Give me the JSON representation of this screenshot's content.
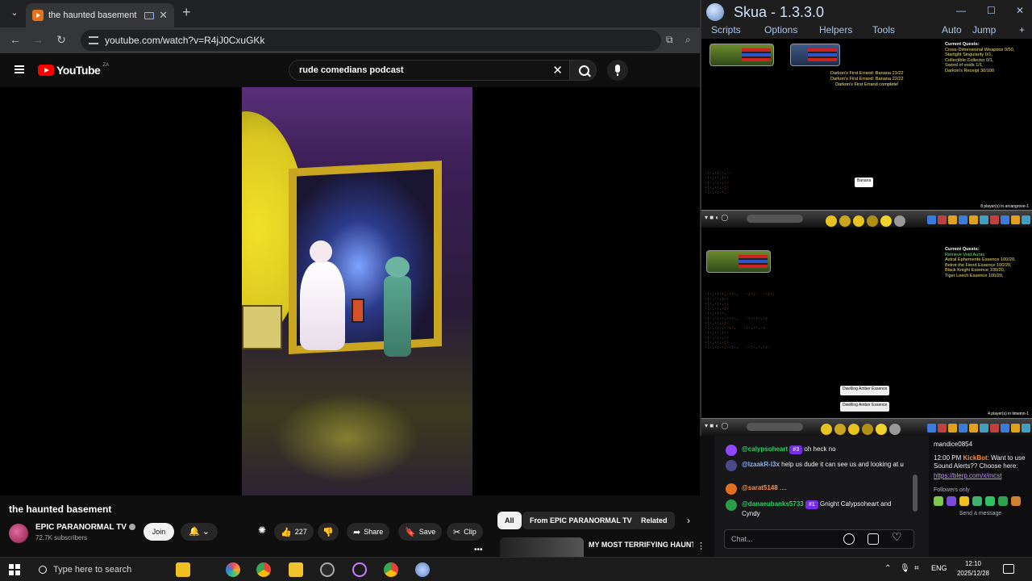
{
  "browser": {
    "tab_title": "the haunted basement - Yo",
    "url": "youtube.com/watch?v=R4jJ0CxuGKk"
  },
  "youtube": {
    "logo_text": "YouTube",
    "country_code": "ZA",
    "search_query": "rude comedians podcast",
    "video_title": "the haunted basement",
    "channel_name": "EPIC PARANORMAL TV",
    "subscribers": "72.7K subscribers",
    "join_label": "Join",
    "likes": "227",
    "share_label": "Share",
    "save_label": "Save",
    "clip_label": "Clip",
    "chips": [
      "All",
      "From EPIC PARANORMAL TV",
      "Related"
    ],
    "reco_title": "MY MOST TERRIFYING HAUNTING | Pocotown School"
  },
  "skua": {
    "title": "Skua - 1.3.3.0",
    "menu": [
      "Scripts",
      "Options",
      "Helpers",
      "Tools",
      "Auto",
      "Jump"
    ],
    "top": {
      "quest_header": "Current Quests:",
      "quests": [
        "Cross-Dimensional Weapons 0/50,",
        "Starlight Singularity 0/1,",
        "Collectible Collector 0/1,",
        "Sword of voids 1/1,",
        "Darkon's Receipt 30/100"
      ],
      "errand_lines": [
        "Darkon's First Errand: Banana 21/22",
        "Darkon's First Errand: Banana 22/22",
        "Darkon's First Errand complete!"
      ],
      "npc": "Banana",
      "players": "8 player(s) in arcangrove-1"
    },
    "bottom": {
      "quest_header": "Current Quests:",
      "quest_sub": "Retrieve Void Auras",
      "quests": [
        "Astral Ephemerite Essence 100/20,",
        "Belrot the Fiend Essence 100/20,",
        "Black Knight Essence 100/20,",
        "Tiger Leech Essence 100/20,"
      ],
      "npc": "Dwelling Amber Essence",
      "players": "4 player(s) in timeinn-1"
    }
  },
  "chat": {
    "messages": [
      {
        "user": "@calypsoheart",
        "badge": "#3",
        "text": "oh heck no",
        "color": "#1ed760",
        "av": "#9147ff"
      },
      {
        "user": "@IzaakR-l3x",
        "text": "help us dude it can see us and looking at u",
        "color": "#8ab4f8",
        "av": "#4a4a8a"
      },
      {
        "user": "@sarat5148",
        "text": "....",
        "color": "#ff8c33",
        "av": "#e07020"
      },
      {
        "user": "@danaeubanks5733",
        "badge": "#1",
        "text": "Gnight Calypsoheart and Cyndy",
        "color": "#1ed760",
        "av": "#2a9d4a"
      }
    ],
    "placeholder": "Chat...",
    "side_user": "mandice0854",
    "bot_time": "12:00 PM",
    "bot_name": "KickBot",
    "bot_text": "Want to use Sound Alerts?? Choose here:",
    "bot_link": "https://blerp.com/x/mcst",
    "followers_only": "Followers only",
    "send_label": "Send a message"
  },
  "taskbar": {
    "search_placeholder": "Type here to search",
    "lang": "ENG",
    "time": "12:10",
    "date": "2025/12/28"
  }
}
